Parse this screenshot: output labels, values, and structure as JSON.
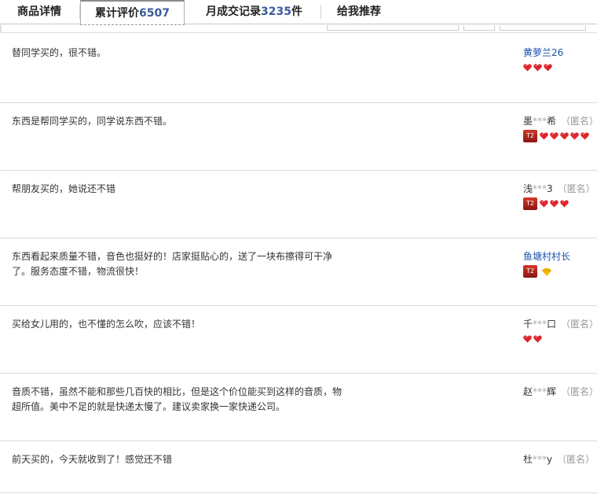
{
  "tabs": [
    {
      "label": "商品详情",
      "count": ""
    },
    {
      "label": "累计评价",
      "count": "6507"
    },
    {
      "label": "月成交记录",
      "count": "3235",
      "suffix": "件"
    },
    {
      "label": "给我推荐",
      "count": ""
    }
  ],
  "reviews": [
    {
      "content": "替同学买的，很不错。",
      "user_pre": "黄萝兰26",
      "mask": "",
      "user_post": "",
      "anon": "",
      "level_badge": "",
      "hearts": 3,
      "diamond": false,
      "link": true
    },
    {
      "content": "东西是帮同学买的，同学说东西不错。",
      "user_pre": "墨",
      "mask": "***",
      "user_post": "希",
      "anon": "（匿名）",
      "level_badge": "T2",
      "hearts": 5,
      "diamond": false,
      "link": false
    },
    {
      "content": "帮朋友买的，她说还不错",
      "user_pre": "浅",
      "mask": "***",
      "user_post": "3",
      "anon": "（匿名）",
      "level_badge": "T2",
      "hearts": 3,
      "diamond": false,
      "link": false
    },
    {
      "content": "东西看起来质量不错，音色也挺好的！店家挺贴心的，送了一块布擦得可干净了。服务态度不错，物流很快！",
      "user_pre": "鱼塘村村长",
      "mask": "",
      "user_post": "",
      "anon": "",
      "level_badge": "T2",
      "hearts": 0,
      "diamond": true,
      "link": true
    },
    {
      "content": "买给女儿用的，也不懂的怎么吹，应该不错！",
      "user_pre": "千",
      "mask": "***",
      "user_post": "口",
      "anon": "（匿名）",
      "level_badge": "",
      "hearts": 2,
      "diamond": false,
      "link": false
    },
    {
      "content": "音质不错，虽然不能和那些几百快的相比，但是这个价位能买到这样的音质，物超所值。美中不足的就是快递太慢了。建议卖家换一家快递公司。",
      "user_pre": "赵",
      "mask": "***",
      "user_post": "辉",
      "anon": "（匿名）",
      "level_badge": "",
      "hearts": 0,
      "diamond": false,
      "link": false
    },
    {
      "content": "前天买的，今天就收到了！感觉还不错",
      "user_pre": "杜",
      "mask": "***",
      "user_post": "y",
      "anon": "（匿名）",
      "level_badge": "",
      "hearts": 0,
      "diamond": false,
      "link": false
    }
  ],
  "colors": {
    "heart": "#e0262c",
    "diamond": "#f2b705",
    "link": "#1a50a8",
    "count": "#3b5b9c"
  },
  "icons": {
    "heart": "heart-icon",
    "diamond": "diamond-icon",
    "level": "t2-level-icon"
  }
}
